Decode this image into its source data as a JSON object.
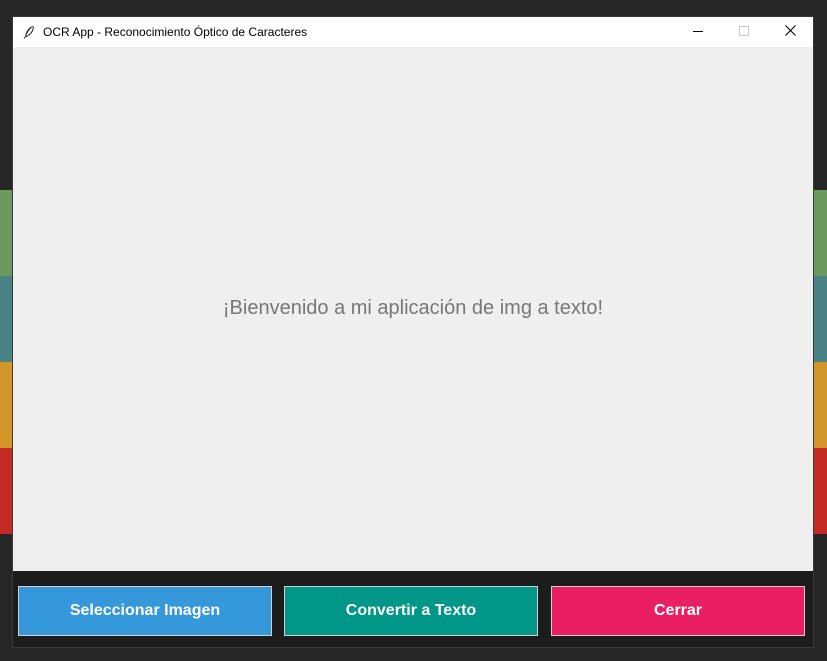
{
  "window": {
    "title": "OCR App - Reconocimiento Óptico de Caracteres",
    "controls": {
      "minimize_icon": "minimize-icon",
      "maximize_icon": "maximize-icon",
      "close_icon": "close-icon"
    }
  },
  "main": {
    "welcome_text": "¡Bienvenido a mi aplicación de img a texto!"
  },
  "buttons": {
    "select_label": "Seleccionar Imagen",
    "convert_label": "Convertir a Texto",
    "close_label": "Cerrar"
  },
  "colors": {
    "select_button": "#3498db",
    "convert_button": "#009688",
    "close_button": "#e91e63",
    "content_background": "#efefef",
    "button_bar_background": "#1c1c1c"
  }
}
